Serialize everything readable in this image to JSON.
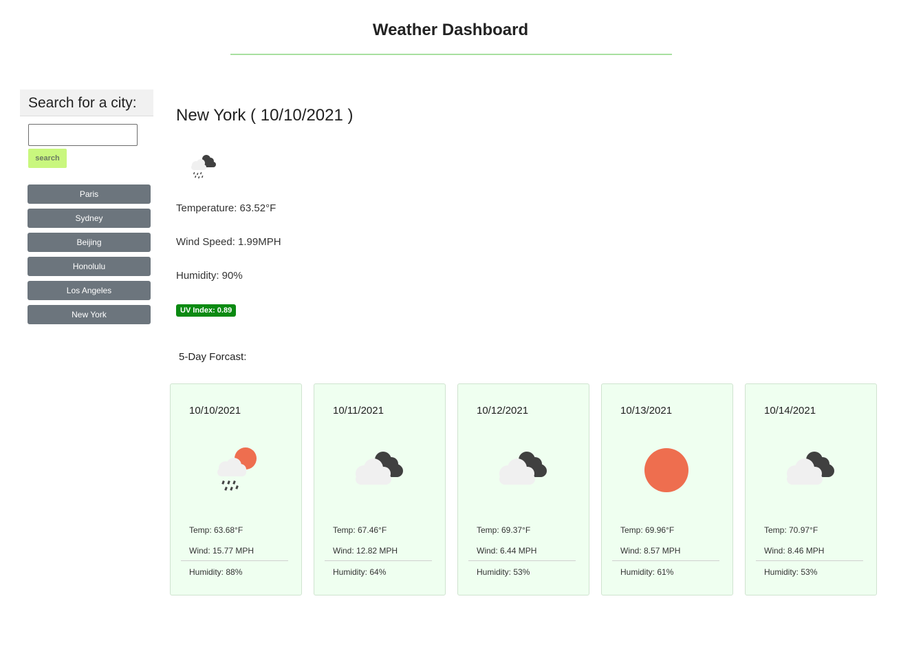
{
  "header": {
    "title": "Weather Dashboard"
  },
  "sidebar": {
    "title": "Search for a city:",
    "search_placeholder": "",
    "search_label": "search",
    "cities": [
      "Paris",
      "Sydney",
      "Beijing",
      "Honolulu",
      "Los Angeles",
      "New York"
    ]
  },
  "current": {
    "heading": "New York ( 10/10/2021 )",
    "icon": "dark-cloud-rain-icon",
    "temperature": "Temperature: 63.52°F",
    "wind": "Wind Speed: 1.99MPH",
    "humidity": "Humidity: 90%",
    "uv": "UV Index: 0.89",
    "uv_color": "#0b8a12"
  },
  "forecast": {
    "title": "5-Day Forcast:",
    "days": [
      {
        "date": "10/10/2021",
        "icon": "sun-cloud-rain-icon",
        "temp": "Temp: 63.68°F",
        "wind": "Wind: 15.77 MPH",
        "humidity": "Humidity: 88%"
      },
      {
        "date": "10/11/2021",
        "icon": "broken-clouds-icon",
        "temp": "Temp: 67.46°F",
        "wind": "Wind: 12.82 MPH",
        "humidity": "Humidity: 64%"
      },
      {
        "date": "10/12/2021",
        "icon": "broken-clouds-icon",
        "temp": "Temp: 69.37°F",
        "wind": "Wind: 6.44 MPH",
        "humidity": "Humidity: 53%"
      },
      {
        "date": "10/13/2021",
        "icon": "sun-icon",
        "temp": "Temp: 69.96°F",
        "wind": "Wind: 8.57 MPH",
        "humidity": "Humidity: 61%"
      },
      {
        "date": "10/14/2021",
        "icon": "broken-clouds-icon",
        "temp": "Temp: 70.97°F",
        "wind": "Wind: 8.46 MPH",
        "humidity": "Humidity: 53%"
      }
    ]
  },
  "colors": {
    "accent_rule": "#a8e0a0",
    "search_button": "#c9f77e",
    "city_button": "#6c757d",
    "card_bg": "#effff0",
    "sun": "#ee6e4f"
  }
}
